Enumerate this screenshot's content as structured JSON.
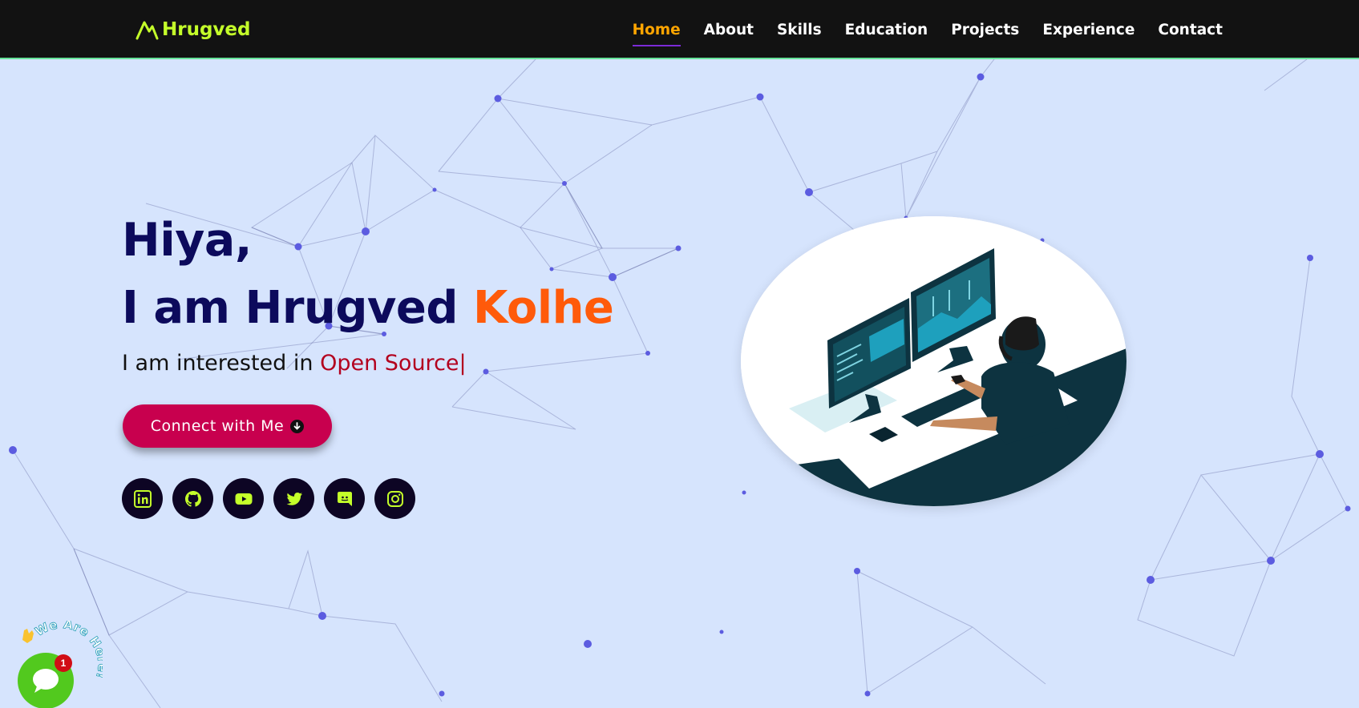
{
  "nav": {
    "logo_text": "Hrugved",
    "links": [
      {
        "label": "Home",
        "active": true
      },
      {
        "label": "About"
      },
      {
        "label": "Skills"
      },
      {
        "label": "Education"
      },
      {
        "label": "Projects"
      },
      {
        "label": "Experience"
      },
      {
        "label": "Contact"
      }
    ]
  },
  "hero": {
    "greeting": "Hiya,",
    "name_prefix": "I am Hrugved ",
    "name_last": "Kolhe",
    "interest_prefix": "I am interested in ",
    "interest_typed": "Open Source",
    "cursor": "|",
    "connect_label": "Connect with Me"
  },
  "socials": [
    {
      "icon": "linkedin-icon"
    },
    {
      "icon": "github-icon"
    },
    {
      "icon": "youtube-icon"
    },
    {
      "icon": "twitter-icon"
    },
    {
      "icon": "discord-icon"
    },
    {
      "icon": "instagram-icon"
    }
  ],
  "chat": {
    "label": "We Are Here!",
    "badge_count": "1",
    "wave_icon": "waving-hand-icon"
  },
  "colors": {
    "background": "#d6e4fd",
    "nav_bg": "#121212",
    "logo": "#c4ff2a",
    "nav_active": "#ffa500",
    "heading": "#0c0a5c",
    "accent_orange": "#ff5a0a",
    "typed_red": "#b3001e",
    "button": "#c8004e",
    "social_bg": "#0d0524",
    "social_icon": "#c4ff2a",
    "chat_green": "#52c91e"
  }
}
